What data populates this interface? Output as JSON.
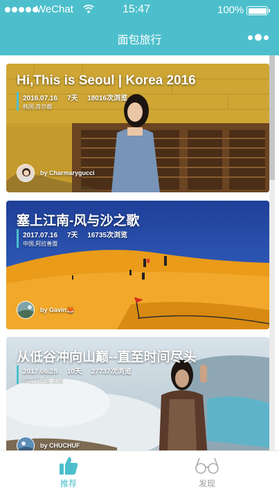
{
  "status_bar": {
    "carrier": "WeChat",
    "time": "15:47",
    "battery": "100%"
  },
  "nav": {
    "title": "面包旅行"
  },
  "trips": [
    {
      "title": "Hi,This is Seoul | Korea 2016",
      "date": "2016.07.16",
      "days": "7天",
      "views": "18016次浏览",
      "location": "韩国,首尔都",
      "author": "by Charmarygucci"
    },
    {
      "title": "塞上江南-风与沙之歌",
      "date": "2017.07.16",
      "days": "7天",
      "views": "16735次浏览",
      "location": "中国,阿拉善盟",
      "author": "by Gavin🦊"
    },
    {
      "title": "从低谷冲向山巅--直至时间尽头",
      "date": "2017.06.28",
      "days": "10天",
      "views": "27737次浏览",
      "location": "印度尼西亚,日惹",
      "author": "by CHUCHUF"
    }
  ],
  "tabs": [
    {
      "label": "推荐",
      "icon": "thumbs-up-icon",
      "active": true
    },
    {
      "label": "发现",
      "icon": "glasses-icon",
      "active": false
    }
  ],
  "colors": {
    "accent": "#4dbfcc",
    "inactive": "#999999"
  }
}
